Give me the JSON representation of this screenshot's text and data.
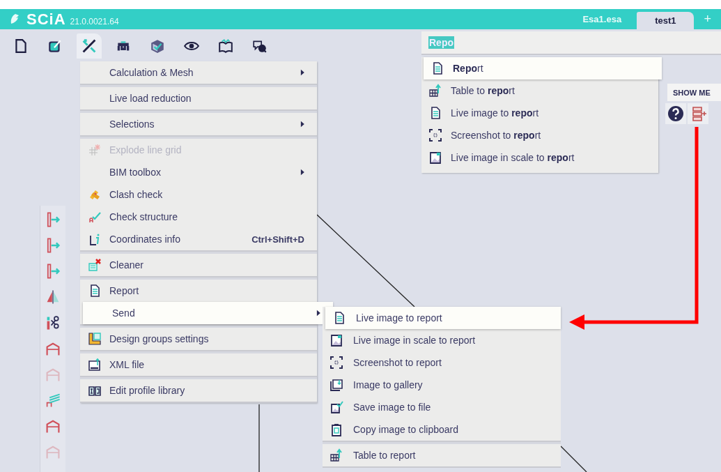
{
  "title_bar": {
    "logo": "SCiA",
    "version": "21.0.0021.64",
    "tabs": [
      {
        "label": "Esa1.esa",
        "selected": false
      },
      {
        "label": "test1",
        "selected": true
      }
    ],
    "add_tab": "+"
  },
  "toolbar": [
    {
      "selected": false
    },
    {
      "selected": false
    },
    {
      "selected": true
    },
    {
      "selected": false
    },
    {
      "selected": false
    },
    {
      "selected": false
    },
    {
      "selected": false
    },
    {
      "selected": false
    }
  ],
  "side_toolbar": [
    {
      "disabled": false
    },
    {
      "disabled": false
    },
    {
      "disabled": false
    },
    {
      "disabled": false
    },
    {
      "disabled": false
    },
    {
      "disabled": false
    },
    {
      "disabled": true
    },
    {
      "disabled": false
    },
    {
      "disabled": false
    },
    {
      "disabled": true
    }
  ],
  "menu": {
    "groups": [
      {
        "items": [
          {
            "label": "Calculation & Mesh",
            "submenu": true,
            "disabled": false,
            "selected": false
          }
        ]
      },
      {
        "items": [
          {
            "label": "Live load reduction",
            "submenu": false,
            "disabled": false,
            "selected": false
          }
        ]
      },
      {
        "items": [
          {
            "label": "Selections",
            "submenu": true,
            "disabled": false,
            "selected": false
          }
        ]
      },
      {
        "items": [
          {
            "label": "Explode line grid",
            "submenu": false,
            "disabled": true,
            "selected": false
          },
          {
            "label": "BIM toolbox",
            "submenu": true,
            "disabled": false,
            "selected": false
          },
          {
            "label": "Clash check",
            "submenu": false,
            "disabled": false,
            "selected": false
          },
          {
            "label": "Check structure",
            "submenu": false,
            "disabled": false,
            "selected": false
          },
          {
            "label": "Coordinates info",
            "shortcut": "Ctrl+Shift+D",
            "submenu": false,
            "disabled": false,
            "selected": false
          }
        ]
      },
      {
        "items": [
          {
            "label": "Cleaner",
            "submenu": false,
            "disabled": false,
            "selected": false
          }
        ]
      },
      {
        "items": [
          {
            "label": "Report",
            "submenu": false,
            "disabled": false,
            "selected": false
          },
          {
            "label": "Send",
            "submenu": true,
            "disabled": false,
            "selected": true
          }
        ]
      },
      {
        "items": [
          {
            "label": "Design groups settings",
            "submenu": false,
            "disabled": false,
            "selected": false
          }
        ]
      },
      {
        "items": [
          {
            "label": "XML file",
            "submenu": false,
            "disabled": false,
            "selected": false
          }
        ]
      },
      {
        "items": [
          {
            "label": "Edit profile library",
            "submenu": false,
            "disabled": false,
            "selected": false
          }
        ]
      }
    ]
  },
  "search": {
    "value": "Repo",
    "results": [
      {
        "label": "**Repo**rt",
        "selected": true
      },
      {
        "label": "Table to **repo**rt",
        "selected": false
      },
      {
        "label": "Live image to **repo**rt",
        "selected": false
      },
      {
        "label": "Screenshot to **repo**rt",
        "selected": false
      },
      {
        "label": "Live image in scale to **repo**rt",
        "selected": false
      }
    ]
  },
  "show_me": "SHOW ME",
  "send_submenu": {
    "groups": [
      {
        "items": [
          {
            "label": "Live image to report",
            "selected": true
          },
          {
            "label": "Live image in scale to report",
            "selected": false
          },
          {
            "label": "Screenshot to report",
            "selected": false
          },
          {
            "label": "Image to gallery",
            "selected": false
          },
          {
            "label": "Save image to file",
            "selected": false
          },
          {
            "label": "Copy image to clipboard",
            "selected": false
          }
        ]
      },
      {
        "items": [
          {
            "label": "Table to report",
            "selected": false
          }
        ]
      }
    ]
  }
}
